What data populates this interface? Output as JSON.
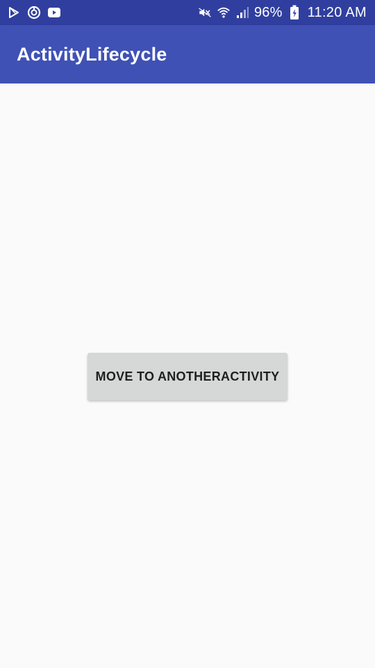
{
  "status_bar": {
    "icons_left": [
      "play-store-icon",
      "sync-circle-icon",
      "youtube-icon"
    ],
    "icons_right": [
      "mute-icon",
      "wifi-icon",
      "signal-icon",
      "battery-charging-icon"
    ],
    "battery_percent": "96%",
    "time": "11:20 AM"
  },
  "app_bar": {
    "title": "ActivityLifecycle"
  },
  "main": {
    "button_label": "MOVE TO ANOTHERACTIVITY"
  },
  "colors": {
    "status_bar": "#303f9f",
    "app_bar": "#3f51b5",
    "background": "#fafafa",
    "button": "#d6d7d7"
  }
}
